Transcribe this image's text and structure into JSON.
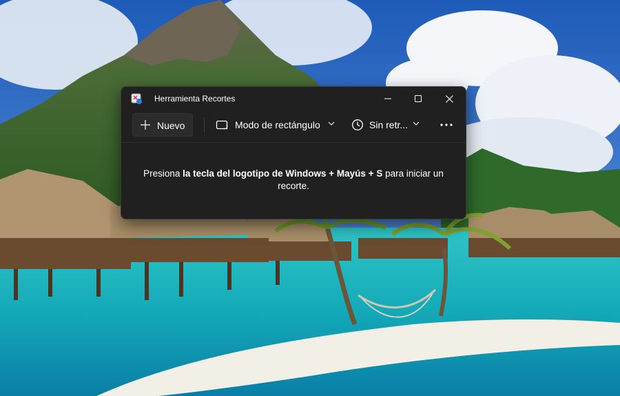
{
  "window": {
    "title": "Herramienta Recortes"
  },
  "toolbar": {
    "new_label": "Nuevo",
    "mode_label": "Modo de rectángulo",
    "delay_label": "Sin retr..."
  },
  "hint": {
    "prefix": "Presiona ",
    "shortcut": "la tecla del logotipo de Windows + Mayús + S",
    "suffix": " para iniciar un recorte."
  },
  "icons": {
    "app": "snipping-tool-icon",
    "new": "plus-icon",
    "mode": "rectangle-mode-icon",
    "delay": "clock-icon",
    "more": "more-dots-icon"
  },
  "colors": {
    "window_bg": "#202020",
    "text": "#ffffff"
  }
}
